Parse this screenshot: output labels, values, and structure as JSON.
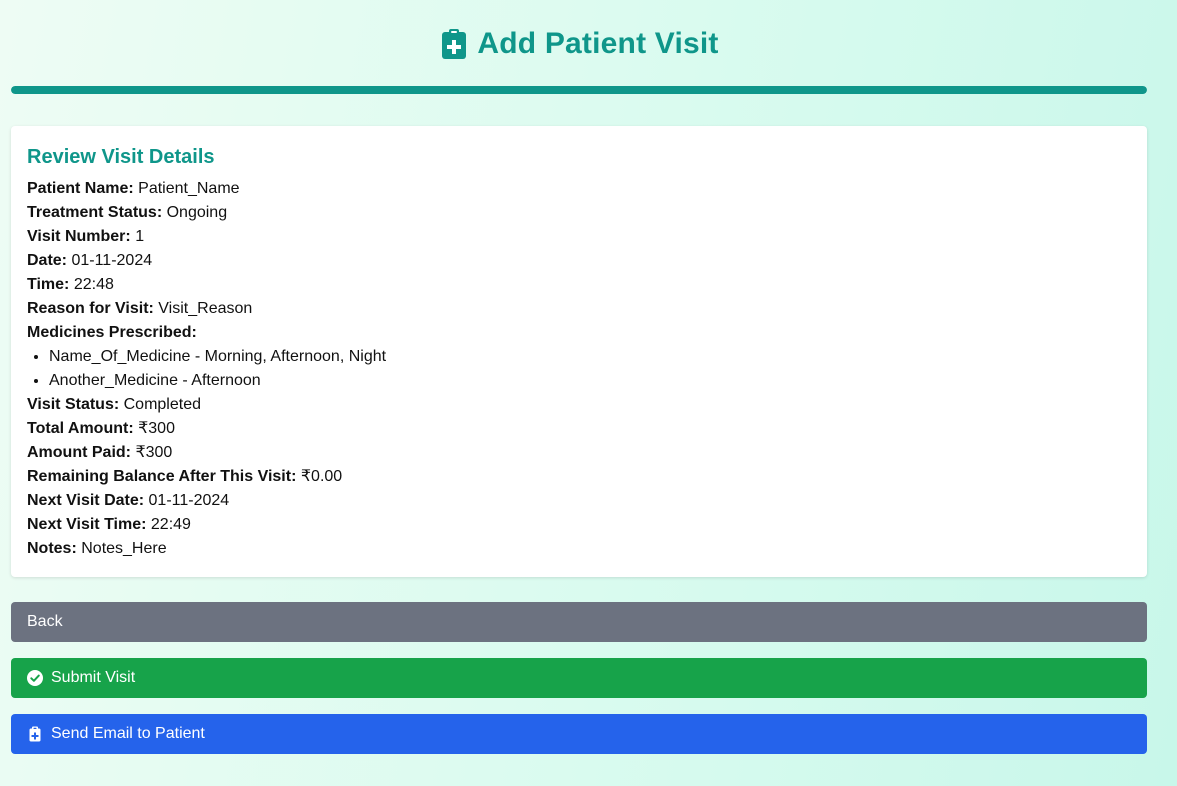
{
  "header": {
    "title": "Add Patient Visit",
    "icon": "clipboard-medical-icon",
    "accent_color": "#0f968a"
  },
  "progress": {
    "percent": 100
  },
  "review": {
    "title": "Review Visit Details",
    "patient_name": {
      "label": "Patient Name:",
      "value": "Patient_Name"
    },
    "treatment_status": {
      "label": "Treatment Status:",
      "value": "Ongoing"
    },
    "visit_number": {
      "label": "Visit Number:",
      "value": "1"
    },
    "date": {
      "label": "Date:",
      "value": "01-11-2024"
    },
    "time": {
      "label": "Time:",
      "value": "22:48"
    },
    "reason": {
      "label": "Reason for Visit:",
      "value": "Visit_Reason"
    },
    "medicines_label": "Medicines Prescribed:",
    "medicines": [
      "Name_Of_Medicine - Morning, Afternoon, Night",
      "Another_Medicine - Afternoon"
    ],
    "visit_status": {
      "label": "Visit Status:",
      "value": "Completed"
    },
    "total_amount": {
      "label": "Total Amount:",
      "value": "₹300"
    },
    "amount_paid": {
      "label": "Amount Paid:",
      "value": "₹300"
    },
    "remaining_balance": {
      "label": "Remaining Balance After This Visit:",
      "value": "₹0.00"
    },
    "next_visit_date": {
      "label": "Next Visit Date:",
      "value": "01-11-2024"
    },
    "next_visit_time": {
      "label": "Next Visit Time:",
      "value": "22:49"
    },
    "notes": {
      "label": "Notes:",
      "value": "Notes_Here"
    }
  },
  "buttons": {
    "back": {
      "label": "Back",
      "color": "#6c7280"
    },
    "submit": {
      "label": "Submit Visit",
      "icon": "check-circle-icon",
      "color": "#17a34a"
    },
    "email": {
      "label": "Send Email to Patient",
      "icon": "clipboard-medical-icon",
      "color": "#2563eb"
    }
  }
}
